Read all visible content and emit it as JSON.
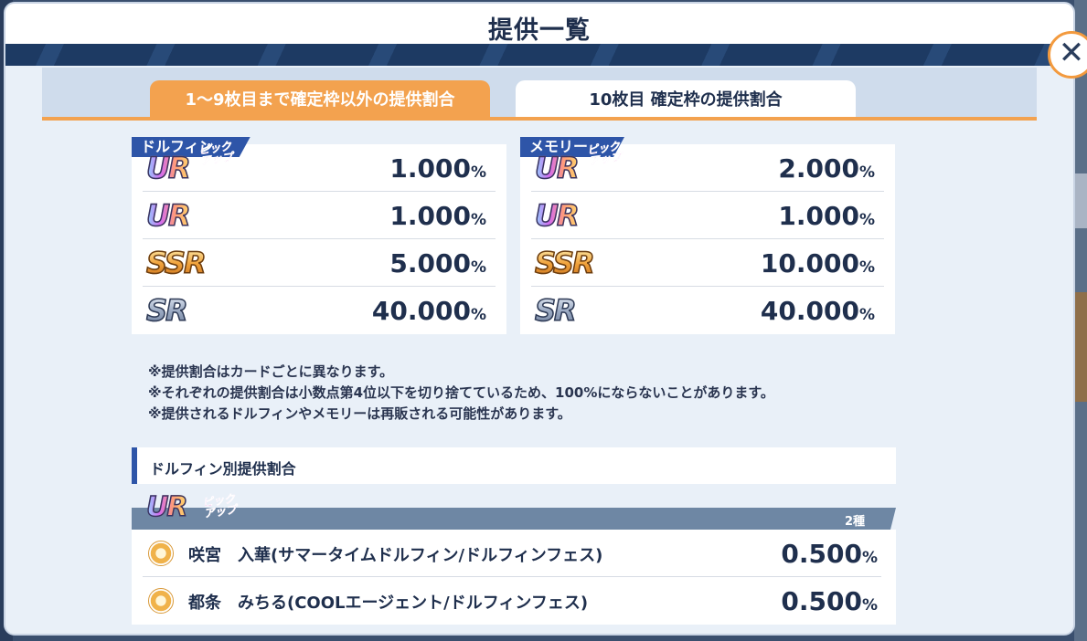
{
  "modal": {
    "title": "提供一覧"
  },
  "tabs": [
    {
      "label": "1〜9枚目まで確定枠以外の提供割合",
      "active": true
    },
    {
      "label": "10枚目 確定枠の提供割合",
      "active": false
    }
  ],
  "dolphin_box": {
    "label": "ドルフィン",
    "rows": [
      {
        "rarity": "UR",
        "pickup": true,
        "value": "1.000",
        "unit": "%"
      },
      {
        "rarity": "UR",
        "pickup": false,
        "value": "1.000",
        "unit": "%"
      },
      {
        "rarity": "SSR",
        "pickup": false,
        "value": "5.000",
        "unit": "%"
      },
      {
        "rarity": "SR",
        "pickup": false,
        "value": "40.000",
        "unit": "%"
      }
    ]
  },
  "memory_box": {
    "label": "メモリー",
    "rows": [
      {
        "rarity": "UR",
        "pickup": true,
        "value": "2.000",
        "unit": "%"
      },
      {
        "rarity": "UR",
        "pickup": false,
        "value": "1.000",
        "unit": "%"
      },
      {
        "rarity": "SSR",
        "pickup": false,
        "value": "10.000",
        "unit": "%"
      },
      {
        "rarity": "SR",
        "pickup": false,
        "value": "40.000",
        "unit": "%"
      }
    ]
  },
  "pickup_badge": "ピック\nアップ",
  "notes": [
    "※提供割合はカードごとに異なります。",
    "※それぞれの提供割合は小数点第4位以下を切り捨てているため、100%にならないことがあります。",
    "※提供されるドルフィンやメモリーは再販される可能性があります。"
  ],
  "section": {
    "title": "ドルフィン別提供割合"
  },
  "group": {
    "rarity": "UR",
    "pickup": true,
    "count": "2種",
    "characters": [
      {
        "name": "咲宮　入華(サマータイムドルフィン/ドルフィンフェス)",
        "value": "0.500",
        "unit": "%"
      },
      {
        "name": "都条　みちる(COOLエージェント/ドルフィンフェス)",
        "value": "0.500",
        "unit": "%"
      }
    ]
  },
  "close_button": {
    "icon": "close-icon",
    "glyph": "✕"
  },
  "colors": {
    "accent_orange": "#f3a24f",
    "navy": "#1f2f4d",
    "label_blue": "#2e55a8"
  }
}
